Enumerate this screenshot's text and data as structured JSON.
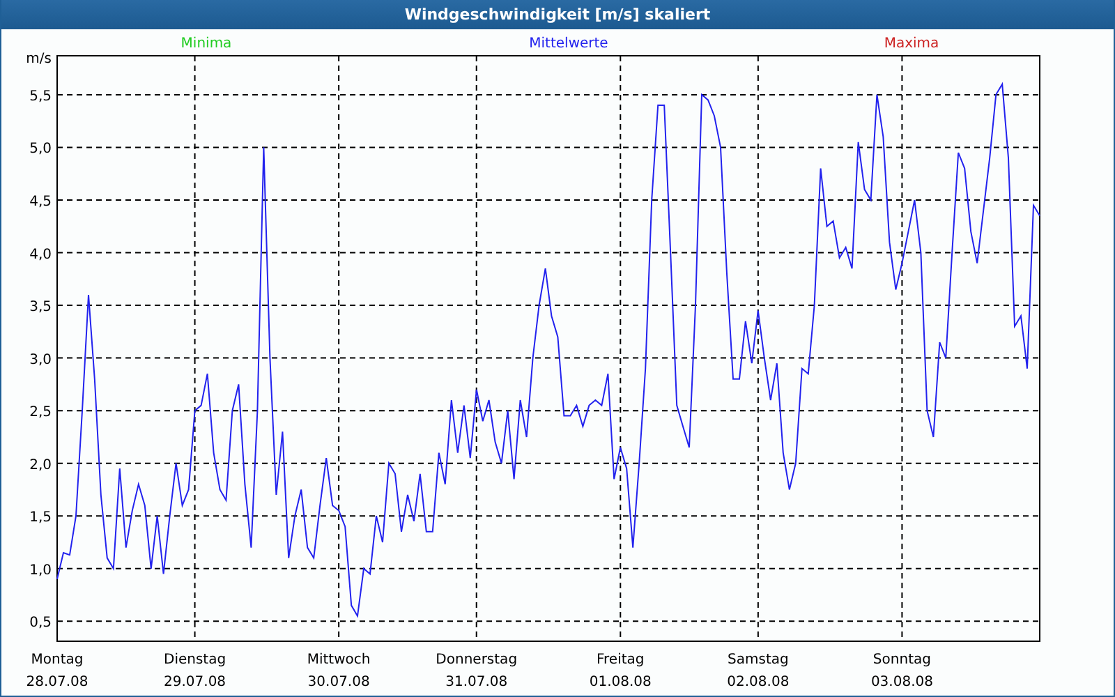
{
  "window": {
    "title": "Windgeschwindigkeit [m/s] skaliert"
  },
  "legend": [
    {
      "label": "Minima",
      "color": "#22cc22"
    },
    {
      "label": "Maxima",
      "color": "#cc2222"
    }
  ],
  "chart_data": {
    "type": "line",
    "ylabel": "m/s",
    "ylim": [
      0.31,
      5.87
    ],
    "grid": true,
    "yticks": [
      {
        "value": 0.5,
        "label": "0,5"
      },
      {
        "value": 1.0,
        "label": "1,0"
      },
      {
        "value": 1.5,
        "label": "1,5"
      },
      {
        "value": 2.0,
        "label": "2,0"
      },
      {
        "value": 2.5,
        "label": "2,5"
      },
      {
        "value": 3.0,
        "label": "3,0"
      },
      {
        "value": 3.5,
        "label": "3,5"
      },
      {
        "value": 4.0,
        "label": "4,0"
      },
      {
        "value": 4.5,
        "label": "4,5"
      },
      {
        "value": 5.0,
        "label": "5,0"
      },
      {
        "value": 5.5,
        "label": "5,5"
      }
    ],
    "categories": [
      "Montag\n28.07.08",
      null,
      null,
      null,
      null,
      null,
      null,
      null,
      null,
      null,
      null,
      null,
      null,
      null,
      null,
      null,
      null,
      null,
      null,
      null,
      null,
      null,
      "Dienstag\n29.07.08",
      null,
      null,
      null,
      null,
      null,
      null,
      null,
      null,
      null,
      null,
      null,
      null,
      null,
      null,
      null,
      null,
      null,
      null,
      null,
      null,
      null,
      null,
      "Mittwoch\n30.07.08",
      null,
      null,
      null,
      null,
      null,
      null,
      null,
      null,
      null,
      null,
      null,
      null,
      null,
      null,
      null,
      null,
      null,
      null,
      null,
      null,
      null,
      "Donnerstag\n31.07.08",
      null,
      null,
      null,
      null,
      null,
      null,
      null,
      null,
      null,
      null,
      null,
      null,
      null,
      null,
      null,
      null,
      null,
      null,
      null,
      null,
      null,
      null,
      "Freitag\n01.08.08",
      null,
      null,
      null,
      null,
      null,
      null,
      null,
      null,
      null,
      null,
      null,
      null,
      null,
      null,
      null,
      null,
      null,
      null,
      null,
      null,
      null,
      "Samstag\n02.08.08",
      null,
      null,
      null,
      null,
      null,
      null,
      null,
      null,
      null,
      null,
      null,
      null,
      null,
      null,
      null,
      null,
      null,
      null,
      null,
      null,
      null,
      null,
      "Sonntag\n03.08.08",
      null,
      null,
      null,
      null,
      null,
      null,
      null,
      null,
      null,
      null,
      null,
      null,
      null,
      null,
      null,
      null,
      null,
      null,
      null,
      null,
      null,
      null
    ],
    "series": [
      {
        "name": "Mittelwerte",
        "color": "#2222ee",
        "values": [
          0.9,
          1.15,
          1.13,
          1.5,
          2.5,
          3.6,
          2.8,
          1.7,
          1.1,
          1.0,
          1.95,
          1.2,
          1.55,
          1.8,
          1.6,
          1.0,
          1.5,
          0.95,
          1.5,
          2.0,
          1.6,
          1.75,
          2.5,
          2.55,
          2.85,
          2.1,
          1.75,
          1.65,
          2.5,
          2.75,
          1.8,
          1.2,
          2.5,
          5.0,
          3.0,
          1.7,
          2.3,
          1.1,
          1.5,
          1.75,
          1.2,
          1.1,
          1.6,
          2.05,
          1.6,
          1.55,
          1.4,
          0.65,
          0.55,
          1.0,
          0.95,
          1.5,
          1.25,
          2.0,
          1.9,
          1.35,
          1.7,
          1.45,
          1.9,
          1.35,
          1.35,
          2.1,
          1.8,
          2.6,
          2.1,
          2.55,
          2.05,
          2.7,
          2.4,
          2.6,
          2.2,
          2.0,
          2.5,
          1.85,
          2.6,
          2.25,
          3.0,
          3.5,
          3.85,
          3.4,
          3.2,
          2.45,
          2.45,
          2.55,
          2.35,
          2.55,
          2.6,
          2.55,
          2.85,
          1.85,
          2.15,
          1.95,
          1.2,
          2.0,
          2.9,
          4.5,
          5.4,
          5.4,
          4.0,
          2.55,
          2.35,
          2.15,
          3.5,
          5.5,
          5.45,
          5.3,
          5.0,
          3.8,
          2.8,
          2.8,
          3.35,
          2.95,
          3.45,
          3.0,
          2.6,
          2.95,
          2.1,
          1.75,
          2.0,
          2.9,
          2.85,
          3.5,
          4.8,
          4.25,
          4.3,
          3.95,
          4.05,
          3.85,
          5.05,
          4.6,
          4.5,
          5.5,
          5.1,
          4.1,
          3.65,
          3.9,
          4.2,
          4.5,
          4.0,
          2.5,
          2.25,
          3.15,
          3.0,
          4.0,
          4.95,
          4.8,
          4.2,
          3.9,
          4.4,
          4.9,
          5.5,
          5.6,
          4.9,
          3.3,
          3.4,
          2.9,
          4.45,
          4.35
        ]
      }
    ]
  }
}
